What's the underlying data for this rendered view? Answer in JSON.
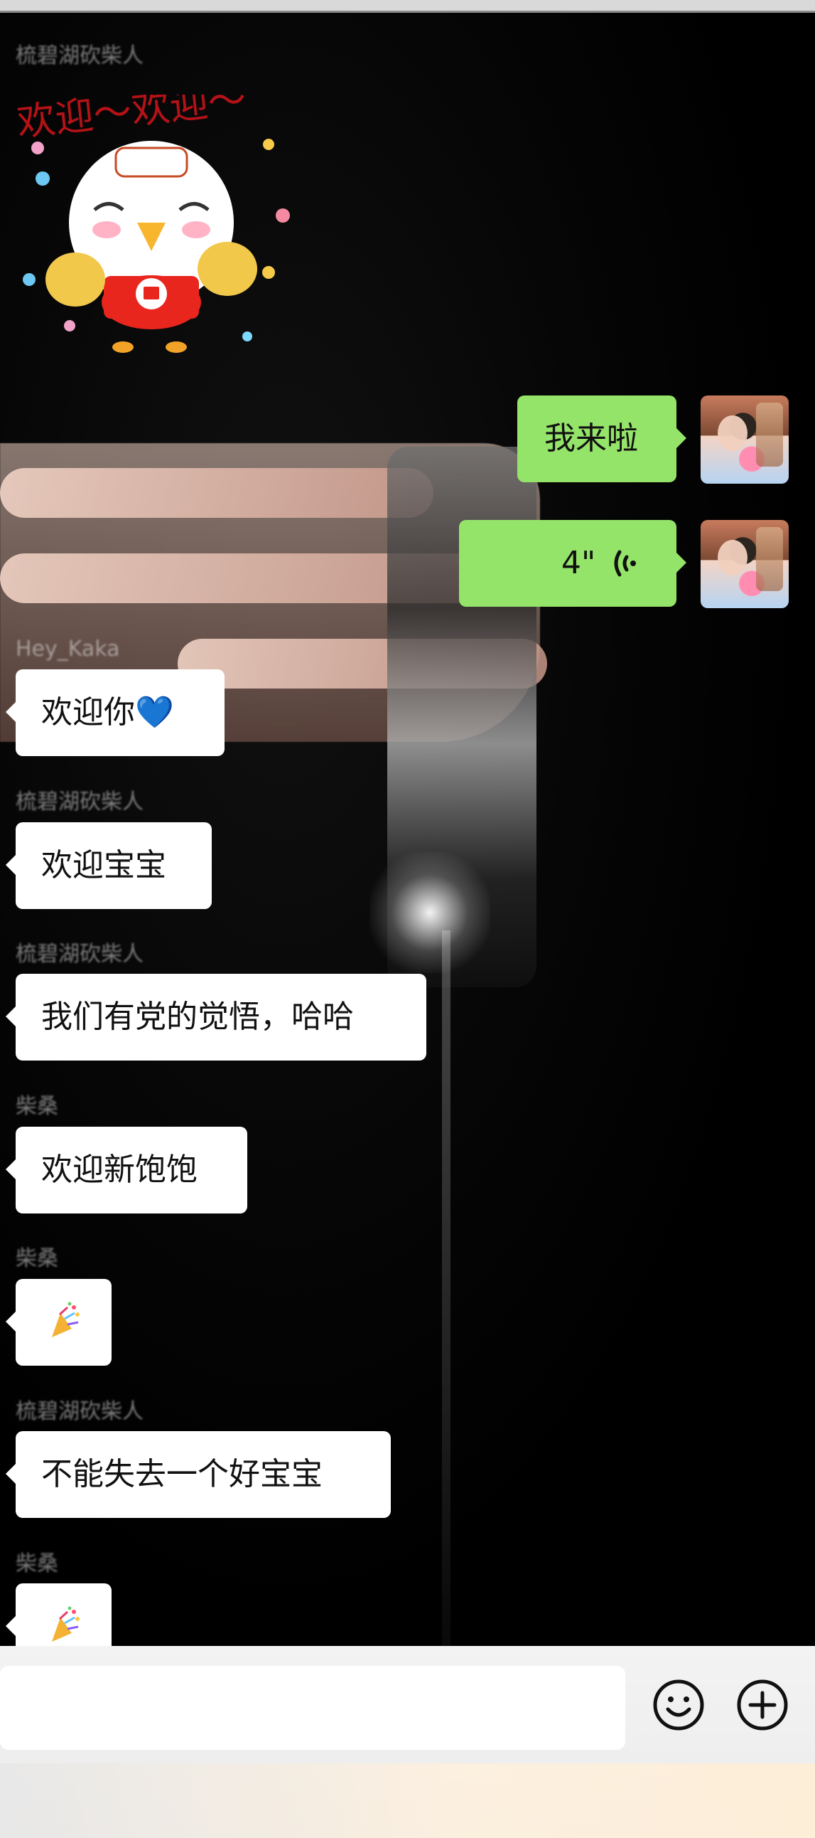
{
  "sticker": {
    "text": "欢迎～欢迎～"
  },
  "messages": [
    {
      "name": "梳碧湖砍柴人",
      "text": "欢迎你💙"
    },
    {
      "name": "梳碧湖砍柴人",
      "text": "欢迎宝宝"
    },
    {
      "name": "梳碧湖砍柴人",
      "text": "我们有党的觉悟，哈哈"
    },
    {
      "name": "梳碧湖砍柴人",
      "text": "欢迎新饱饱"
    },
    {
      "name": "梳碧湖砍柴人",
      "text": "🎉"
    },
    {
      "name": "梳碧湖砍柴人",
      "text": "不能失去一个好宝宝"
    },
    {
      "name": "梳碧湖砍柴人",
      "text": "🎉"
    }
  ],
  "right_messages": [
    {
      "text": "我来啦"
    },
    {
      "text": "4\""
    }
  ],
  "blurred_names": {
    "n1": "梳碧湖砍柴人",
    "n2": "Hey_Kaka",
    "n3": "梳碧湖砍柴人",
    "n4": "梳碧湖砍柴人",
    "n5": "柴桑",
    "n6": "柴桑",
    "n7": "梳碧湖砍柴人",
    "n8": "柴桑"
  },
  "input": {
    "placeholder": ""
  },
  "icons": {
    "emoji": "emoji-icon",
    "plus": "plus-icon",
    "voice": "voice-icon",
    "party": "party-popper-icon"
  },
  "colors": {
    "green_bubble": "#95e46a",
    "white_bubble": "#ffffff",
    "background": "#000000"
  }
}
